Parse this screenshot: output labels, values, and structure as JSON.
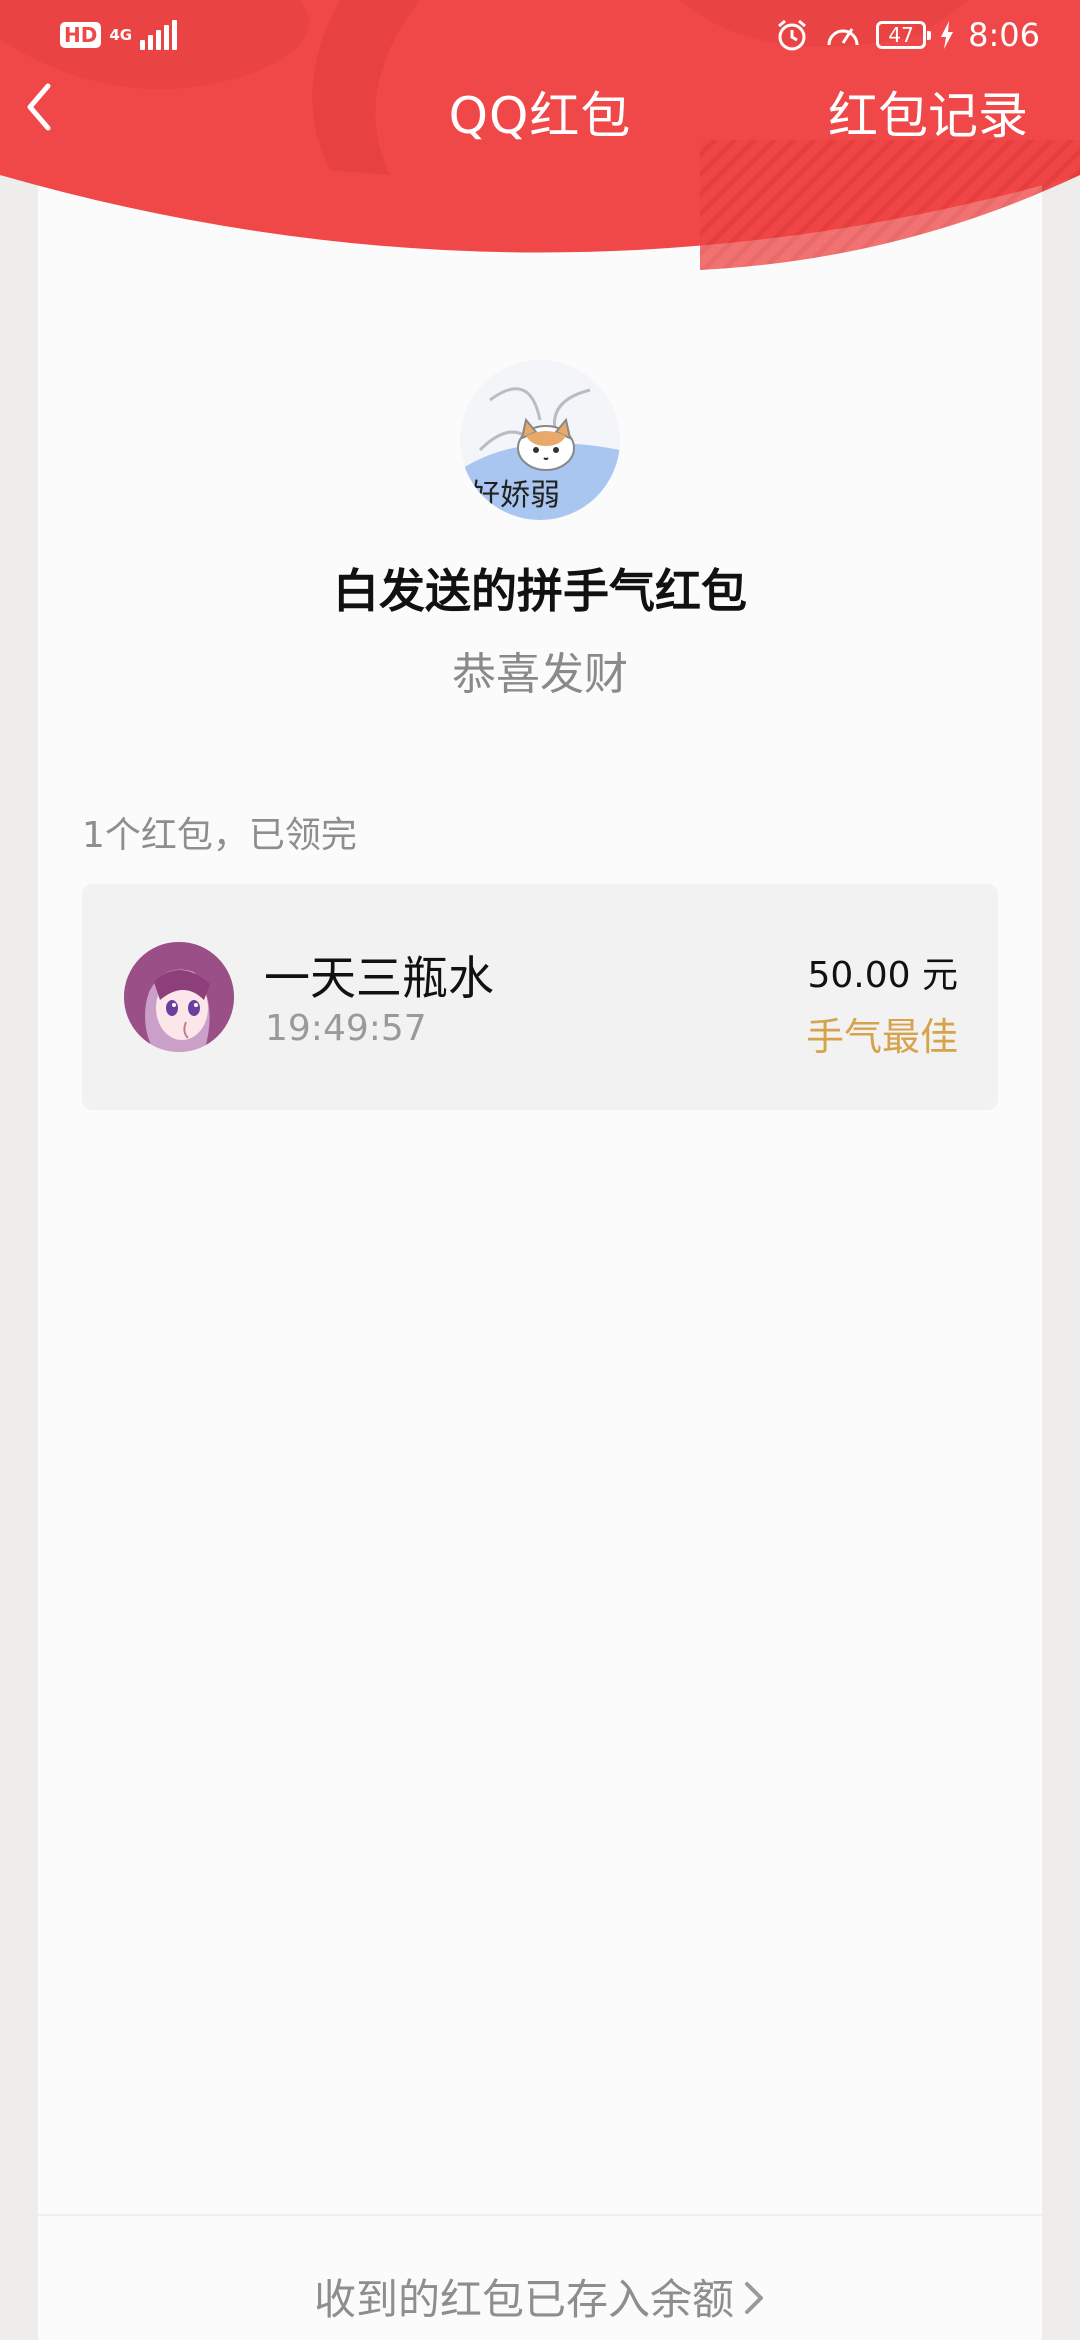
{
  "status_bar": {
    "hd": "HD",
    "network": "4G",
    "battery": "47",
    "time": "8:06"
  },
  "nav": {
    "title": "QQ红包",
    "right_action": "红包记录"
  },
  "sender": {
    "name": "白发送的拼手气红包",
    "greeting": "恭喜发财",
    "avatar_caption": "好娇弱"
  },
  "summary": "1个红包，已领完",
  "receivers": [
    {
      "name": "一天三瓶水",
      "time": "19:49:57",
      "amount": "50.00",
      "currency": "元",
      "badge": "手气最佳"
    }
  ],
  "footer": {
    "link_text": "收到的红包已存入余额"
  },
  "colors": {
    "header_red": "#f04848",
    "best_luck": "#d6a24a"
  }
}
